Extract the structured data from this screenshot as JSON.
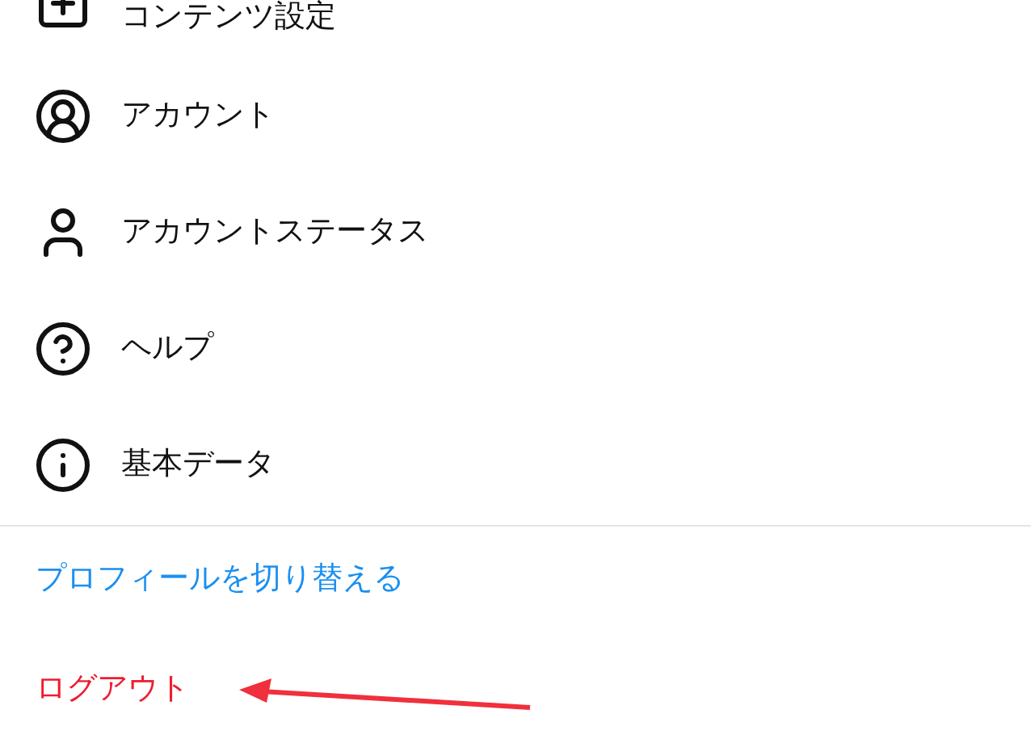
{
  "menu_items": [
    {
      "label": "コンテンツ設定"
    },
    {
      "label": "アカウント"
    },
    {
      "label": "アカウントステータス"
    },
    {
      "label": "ヘルプ"
    },
    {
      "label": "基本データ"
    }
  ],
  "switch_profile_link": "プロフィールを切り替える",
  "logout_link": "ログアウト"
}
